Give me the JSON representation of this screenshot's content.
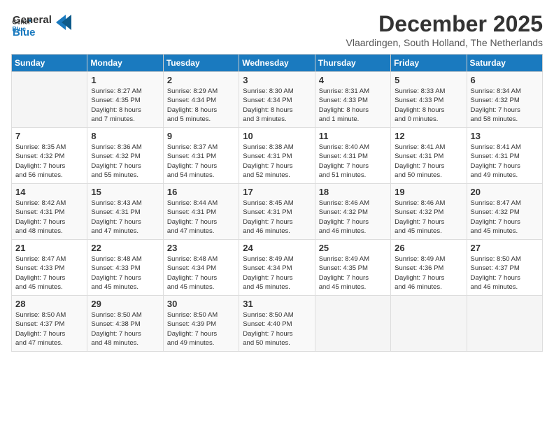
{
  "logo": {
    "text_general": "General",
    "text_blue": "Blue"
  },
  "title": "December 2025",
  "subtitle": "Vlaardingen, South Holland, The Netherlands",
  "header_days": [
    "Sunday",
    "Monday",
    "Tuesday",
    "Wednesday",
    "Thursday",
    "Friday",
    "Saturday"
  ],
  "weeks": [
    [
      {
        "day": "",
        "info": ""
      },
      {
        "day": "1",
        "info": "Sunrise: 8:27 AM\nSunset: 4:35 PM\nDaylight: 8 hours\nand 7 minutes."
      },
      {
        "day": "2",
        "info": "Sunrise: 8:29 AM\nSunset: 4:34 PM\nDaylight: 8 hours\nand 5 minutes."
      },
      {
        "day": "3",
        "info": "Sunrise: 8:30 AM\nSunset: 4:34 PM\nDaylight: 8 hours\nand 3 minutes."
      },
      {
        "day": "4",
        "info": "Sunrise: 8:31 AM\nSunset: 4:33 PM\nDaylight: 8 hours\nand 1 minute."
      },
      {
        "day": "5",
        "info": "Sunrise: 8:33 AM\nSunset: 4:33 PM\nDaylight: 8 hours\nand 0 minutes."
      },
      {
        "day": "6",
        "info": "Sunrise: 8:34 AM\nSunset: 4:32 PM\nDaylight: 7 hours\nand 58 minutes."
      }
    ],
    [
      {
        "day": "7",
        "info": "Sunrise: 8:35 AM\nSunset: 4:32 PM\nDaylight: 7 hours\nand 56 minutes."
      },
      {
        "day": "8",
        "info": "Sunrise: 8:36 AM\nSunset: 4:32 PM\nDaylight: 7 hours\nand 55 minutes."
      },
      {
        "day": "9",
        "info": "Sunrise: 8:37 AM\nSunset: 4:31 PM\nDaylight: 7 hours\nand 54 minutes."
      },
      {
        "day": "10",
        "info": "Sunrise: 8:38 AM\nSunset: 4:31 PM\nDaylight: 7 hours\nand 52 minutes."
      },
      {
        "day": "11",
        "info": "Sunrise: 8:40 AM\nSunset: 4:31 PM\nDaylight: 7 hours\nand 51 minutes."
      },
      {
        "day": "12",
        "info": "Sunrise: 8:41 AM\nSunset: 4:31 PM\nDaylight: 7 hours\nand 50 minutes."
      },
      {
        "day": "13",
        "info": "Sunrise: 8:41 AM\nSunset: 4:31 PM\nDaylight: 7 hours\nand 49 minutes."
      }
    ],
    [
      {
        "day": "14",
        "info": "Sunrise: 8:42 AM\nSunset: 4:31 PM\nDaylight: 7 hours\nand 48 minutes."
      },
      {
        "day": "15",
        "info": "Sunrise: 8:43 AM\nSunset: 4:31 PM\nDaylight: 7 hours\nand 47 minutes."
      },
      {
        "day": "16",
        "info": "Sunrise: 8:44 AM\nSunset: 4:31 PM\nDaylight: 7 hours\nand 47 minutes."
      },
      {
        "day": "17",
        "info": "Sunrise: 8:45 AM\nSunset: 4:31 PM\nDaylight: 7 hours\nand 46 minutes."
      },
      {
        "day": "18",
        "info": "Sunrise: 8:46 AM\nSunset: 4:32 PM\nDaylight: 7 hours\nand 46 minutes."
      },
      {
        "day": "19",
        "info": "Sunrise: 8:46 AM\nSunset: 4:32 PM\nDaylight: 7 hours\nand 45 minutes."
      },
      {
        "day": "20",
        "info": "Sunrise: 8:47 AM\nSunset: 4:32 PM\nDaylight: 7 hours\nand 45 minutes."
      }
    ],
    [
      {
        "day": "21",
        "info": "Sunrise: 8:47 AM\nSunset: 4:33 PM\nDaylight: 7 hours\nand 45 minutes."
      },
      {
        "day": "22",
        "info": "Sunrise: 8:48 AM\nSunset: 4:33 PM\nDaylight: 7 hours\nand 45 minutes."
      },
      {
        "day": "23",
        "info": "Sunrise: 8:48 AM\nSunset: 4:34 PM\nDaylight: 7 hours\nand 45 minutes."
      },
      {
        "day": "24",
        "info": "Sunrise: 8:49 AM\nSunset: 4:34 PM\nDaylight: 7 hours\nand 45 minutes."
      },
      {
        "day": "25",
        "info": "Sunrise: 8:49 AM\nSunset: 4:35 PM\nDaylight: 7 hours\nand 45 minutes."
      },
      {
        "day": "26",
        "info": "Sunrise: 8:49 AM\nSunset: 4:36 PM\nDaylight: 7 hours\nand 46 minutes."
      },
      {
        "day": "27",
        "info": "Sunrise: 8:50 AM\nSunset: 4:37 PM\nDaylight: 7 hours\nand 46 minutes."
      }
    ],
    [
      {
        "day": "28",
        "info": "Sunrise: 8:50 AM\nSunset: 4:37 PM\nDaylight: 7 hours\nand 47 minutes."
      },
      {
        "day": "29",
        "info": "Sunrise: 8:50 AM\nSunset: 4:38 PM\nDaylight: 7 hours\nand 48 minutes."
      },
      {
        "day": "30",
        "info": "Sunrise: 8:50 AM\nSunset: 4:39 PM\nDaylight: 7 hours\nand 49 minutes."
      },
      {
        "day": "31",
        "info": "Sunrise: 8:50 AM\nSunset: 4:40 PM\nDaylight: 7 hours\nand 50 minutes."
      },
      {
        "day": "",
        "info": ""
      },
      {
        "day": "",
        "info": ""
      },
      {
        "day": "",
        "info": ""
      }
    ]
  ]
}
